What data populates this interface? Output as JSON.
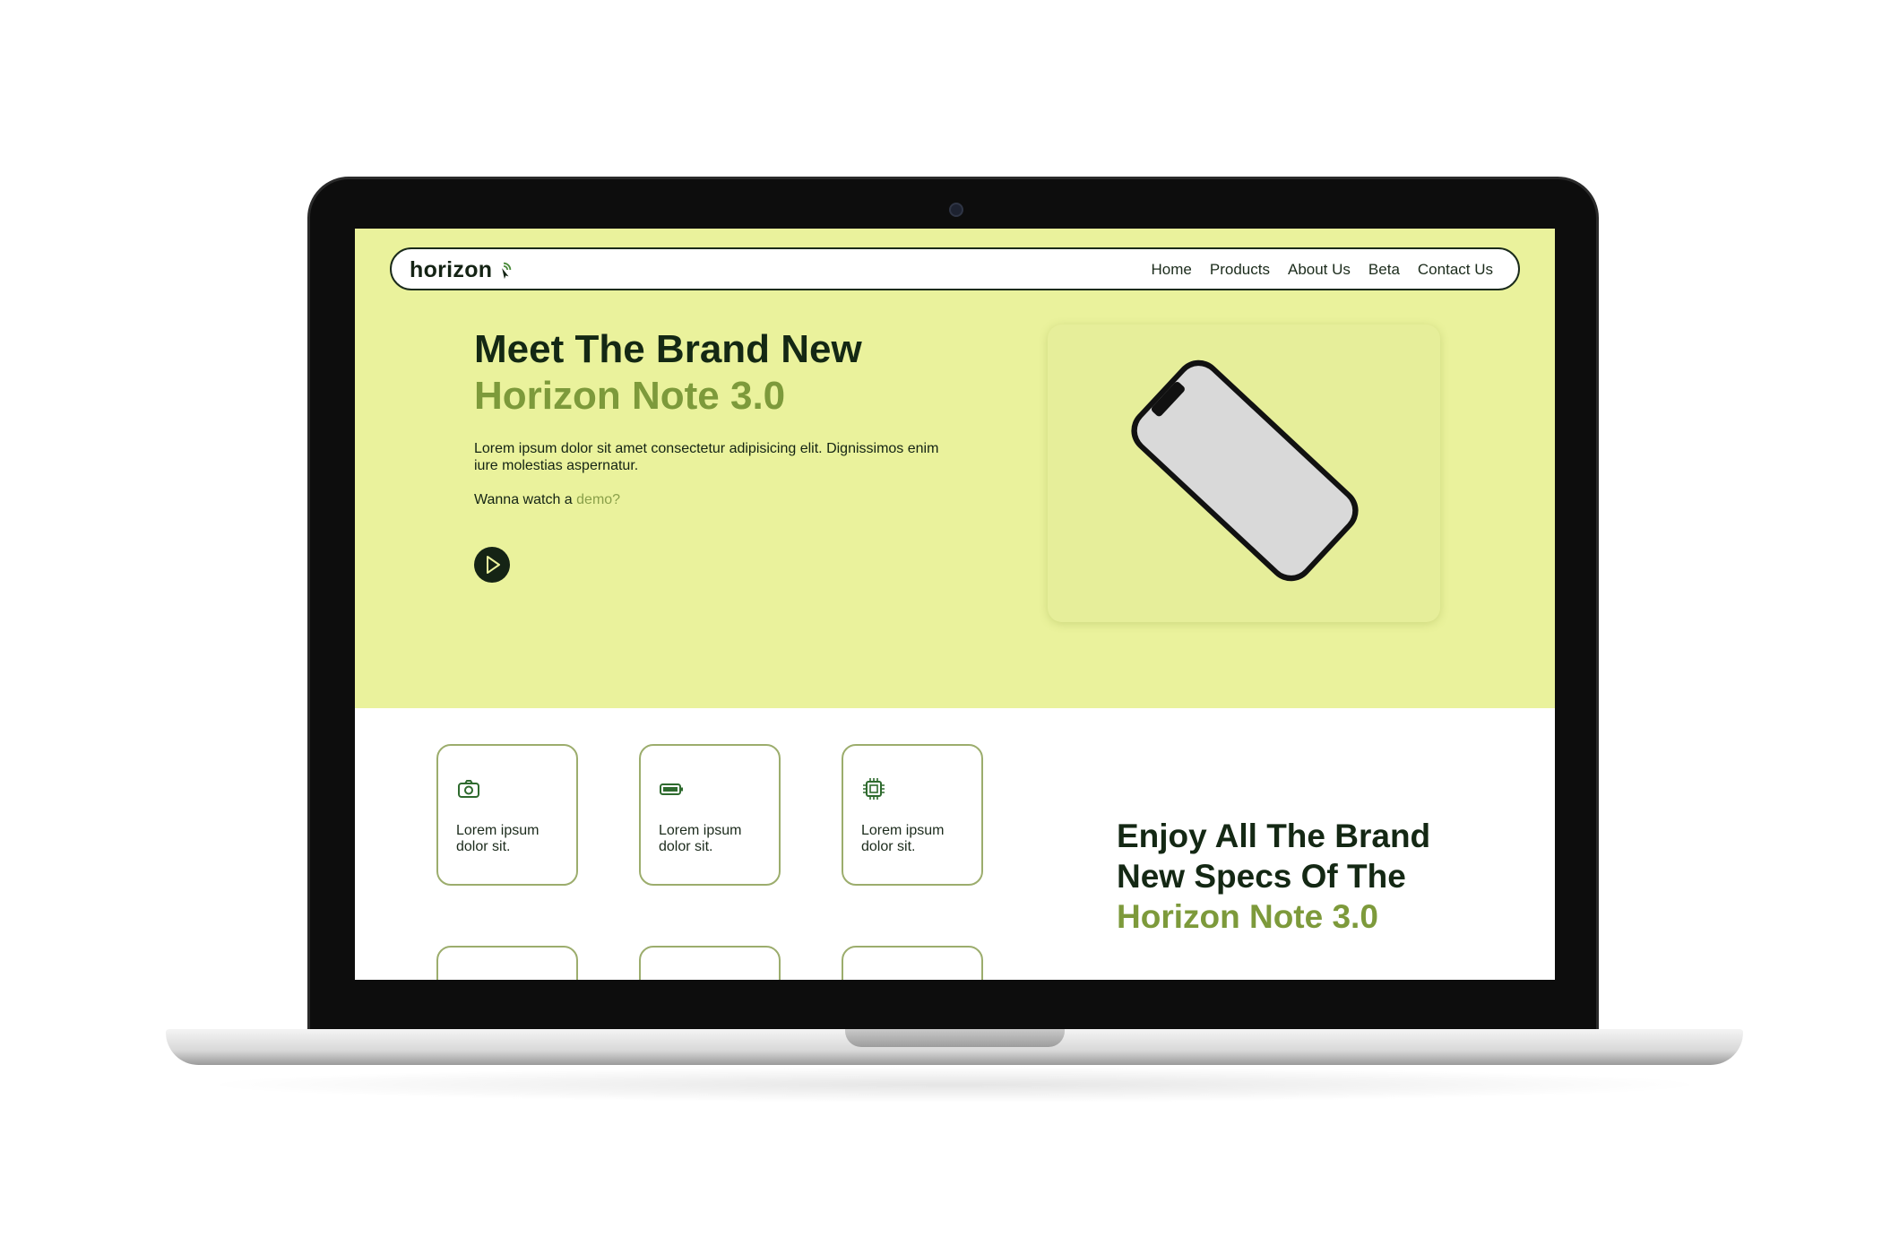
{
  "header": {
    "brand": "horizon",
    "nav": [
      "Home",
      "Products",
      "About Us",
      "Beta",
      "Contact Us"
    ]
  },
  "hero": {
    "title_line1": "Meet The Brand New",
    "title_line2": "Horizon Note 3.0",
    "description": "Lorem ipsum dolor sit amet consectetur adipisicing elit. Dignissimos enim iure molestias aspernatur.",
    "demo_prefix": "Wanna watch a ",
    "demo_link": "demo?"
  },
  "features": [
    {
      "icon": "camera-icon",
      "text": "Lorem ipsum dolor sit."
    },
    {
      "icon": "battery-icon",
      "text": "Lorem ipsum dolor sit."
    },
    {
      "icon": "chip-icon",
      "text": "Lorem ipsum dolor sit."
    }
  ],
  "specs": {
    "title_line1": "Enjoy All The Brand",
    "title_line2": "New Specs Of The",
    "title_line3": "Horizon Note 3.0"
  },
  "colors": {
    "hero_bg": "#eaf29c",
    "dark_green": "#142814",
    "accent_green": "#7d9a3b",
    "card_border": "#9cad6d"
  }
}
